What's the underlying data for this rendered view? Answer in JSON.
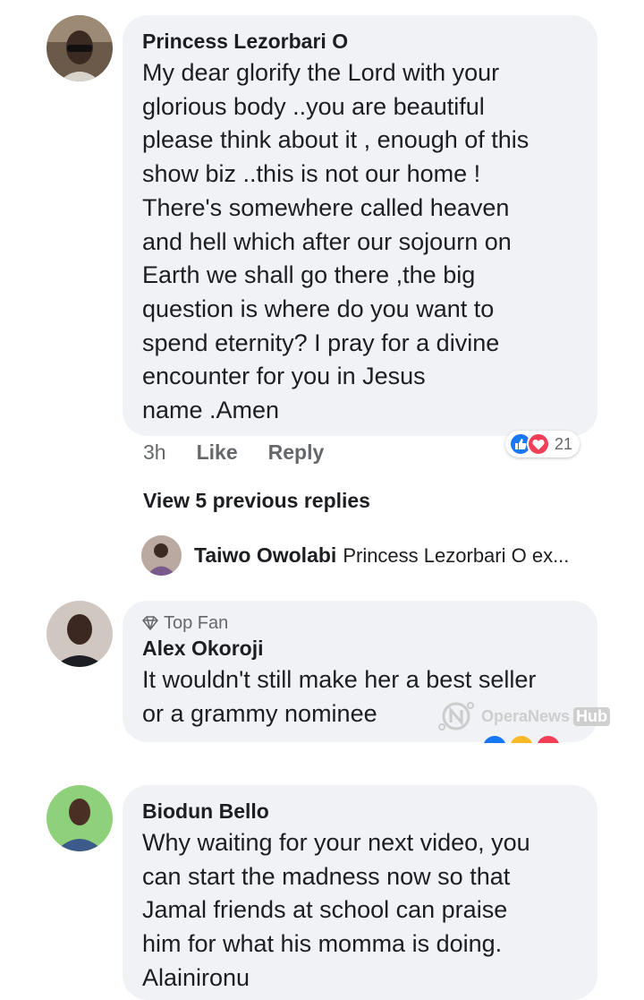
{
  "comments": [
    {
      "author": "Princess Lezorbari O",
      "text": "My dear glorify the Lord with your\nglorious body ..you are beautiful\nplease think about it , enough of this\nshow biz ..this is not our home !\nThere's somewhere called heaven\nand hell which after our sojourn on\nEarth we shall go there ,the big\nquestion is where do you want to\nspend eternity? I pray for a divine\nencounter for you in Jesus\nname .Amen",
      "time": "3h",
      "like_label": "Like",
      "reply_label": "Reply",
      "reaction_count": "21",
      "colors": {
        "like": "#1877f2",
        "love": "#f33e58"
      }
    },
    {
      "badge": "Top Fan",
      "author": "Alex Okoroji",
      "text": "It wouldn't still make her a best seller\nor a grammy nominee"
    },
    {
      "author": "Biodun Bello",
      "text": "Why waiting for your next video, you\ncan start the madness now so that\nJamal friends at school can praise\nhim for what his momma is doing.\nAlainironu"
    }
  ],
  "replies": {
    "view_previous": "View 5 previous replies",
    "latest_author": "Taiwo Owolabi",
    "latest_preview": "Princess Lezorbari O ex..."
  },
  "watermark": {
    "text": "OperaNews",
    "hub": "Hub"
  }
}
